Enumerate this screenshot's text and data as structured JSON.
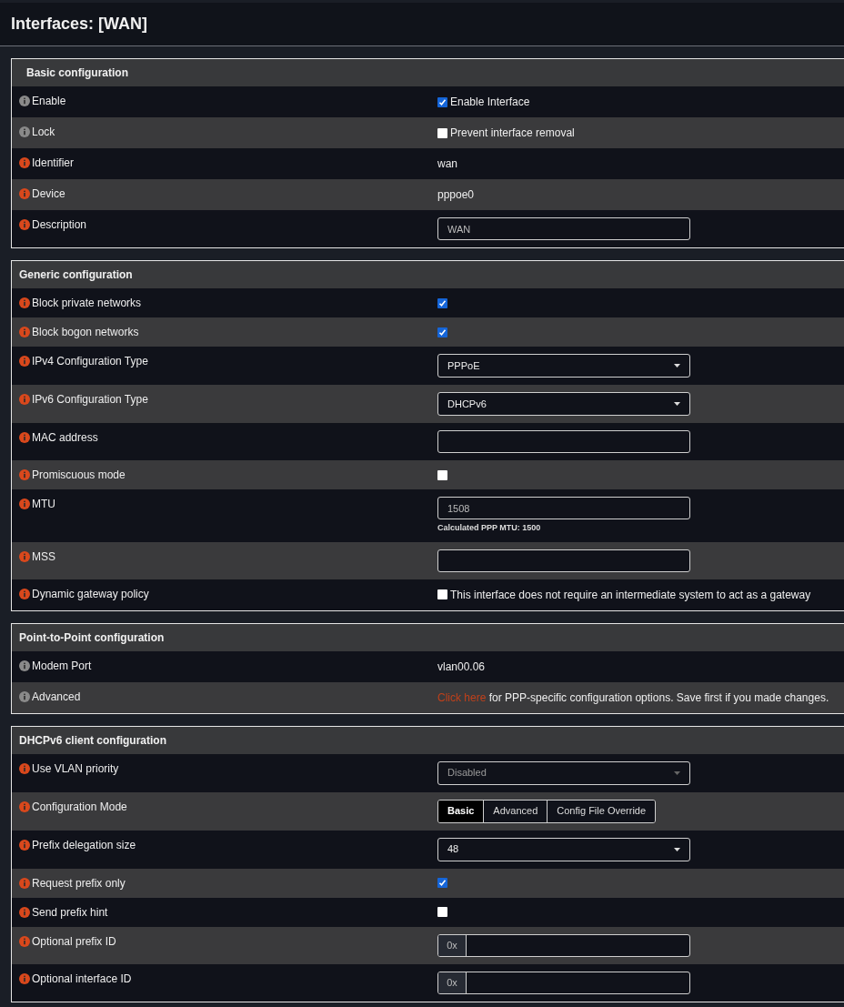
{
  "title": "Interfaces: [WAN]",
  "sections": [
    {
      "title": "Basic configuration",
      "rows": [
        {
          "kind": "checkbox",
          "label": "Enable",
          "color": "#8a8a8a",
          "checked": true,
          "text": "Enable Interface"
        },
        {
          "kind": "checkbox",
          "label": "Lock",
          "color": "#8a8a8a",
          "checked": false,
          "text": "Prevent interface removal"
        },
        {
          "kind": "text",
          "label": "Identifier",
          "color": "#d9481c",
          "value": "wan"
        },
        {
          "kind": "text",
          "label": "Device",
          "color": "#d9481c",
          "value": "pppoe0"
        },
        {
          "kind": "input",
          "label": "Description",
          "color": "#d9481c",
          "value": "WAN"
        }
      ]
    },
    {
      "title": "Generic configuration",
      "rows": [
        {
          "kind": "checkbox",
          "label": "Block private networks",
          "color": "#d9481c",
          "checked": true
        },
        {
          "kind": "checkbox",
          "label": "Block bogon networks",
          "color": "#d9481c",
          "checked": true
        },
        {
          "kind": "select",
          "label": "IPv4 Configuration Type",
          "color": "#d9481c",
          "value": "PPPoE",
          "disabled": false
        },
        {
          "kind": "select",
          "label": "IPv6 Configuration Type",
          "color": "#d9481c",
          "value": "DHCPv6",
          "disabled": false
        },
        {
          "kind": "input",
          "label": "MAC address",
          "color": "#d9481c"
        },
        {
          "kind": "checkbox",
          "label": "Promiscuous mode",
          "color": "#d9481c",
          "checked": false
        },
        {
          "kind": "input",
          "label": "MTU",
          "color": "#d9481c",
          "value": "1508",
          "help": "Calculated PPP MTU: 1500"
        },
        {
          "kind": "input",
          "label": "MSS",
          "color": "#d9481c"
        },
        {
          "kind": "checkbox",
          "label": "Dynamic gateway policy",
          "color": "#d9481c",
          "checked": false,
          "text": "This interface does not require an intermediate system to act as a gateway"
        }
      ]
    },
    {
      "title": "Point-to-Point configuration",
      "rows": [
        {
          "kind": "text",
          "label": "Modem Port",
          "color": "#8a8a8a",
          "value": "vlan00.06"
        },
        {
          "kind": "link",
          "label": "Advanced",
          "color": "#8a8a8a",
          "link": "Click here",
          "text": "for PPP-specific configuration options. Save first if you made changes."
        }
      ]
    },
    {
      "title": "DHCPv6 client configuration",
      "rows": [
        {
          "kind": "select",
          "label": "Use VLAN priority",
          "color": "#d9481c",
          "value": "Disabled",
          "disabled": true
        },
        {
          "kind": "segmented",
          "label": "Configuration Mode",
          "color": "#d9481c",
          "options": [
            {
              "label": "Basic",
              "selected": true
            },
            {
              "label": "Advanced",
              "selected": false
            },
            {
              "label": "Config File Override",
              "selected": false
            }
          ]
        },
        {
          "kind": "select",
          "label": "Prefix delegation size",
          "color": "#d9481c",
          "value": "48",
          "disabled": false
        },
        {
          "kind": "checkbox",
          "label": "Request prefix only",
          "color": "#d9481c",
          "checked": true
        },
        {
          "kind": "checkbox",
          "label": "Send prefix hint",
          "color": "#d9481c",
          "checked": false
        },
        {
          "kind": "prefixed",
          "label": "Optional prefix ID",
          "color": "#d9481c",
          "prefix": "0x"
        },
        {
          "kind": "prefixed",
          "label": "Optional interface ID",
          "color": "#d9481c",
          "prefix": "0x"
        }
      ]
    }
  ]
}
